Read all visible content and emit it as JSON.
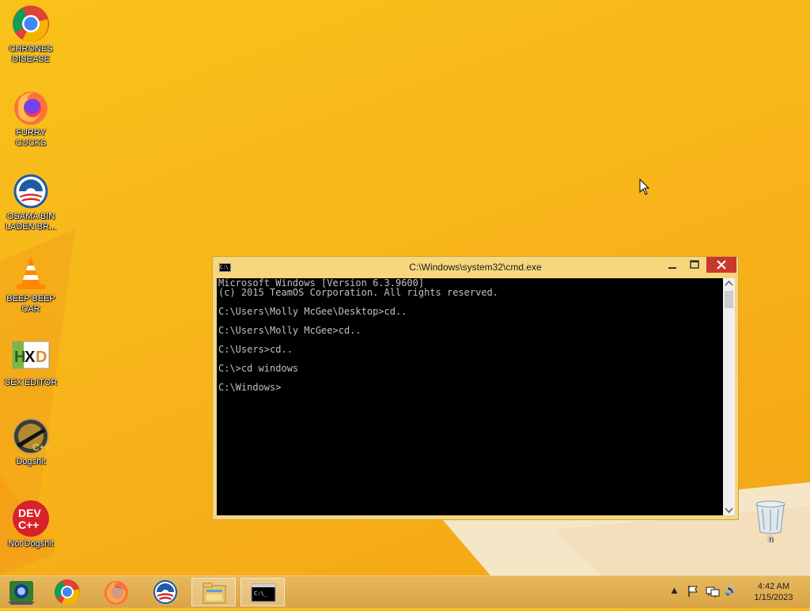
{
  "desktop": {
    "icons": [
      {
        "label": "CHRONES DISEASE",
        "icon": "chrome-icon"
      },
      {
        "label": "FURRY CUCKS",
        "icon": "firefox-icon"
      },
      {
        "label": "OSAMA BIN LADEN BR...",
        "icon": "campaign-logo-icon"
      },
      {
        "label": "BEEP BEEP CAR",
        "icon": "vlc-cone-icon"
      },
      {
        "label": "SEX EDITOR",
        "icon": "hxd-icon"
      },
      {
        "label": "Dogshit",
        "icon": "codeblocks-icon"
      },
      {
        "label": "Not Dogshit",
        "icon": "devcpp-icon"
      }
    ],
    "recycle_bin": {
      "label": "n",
      "icon": "recycle-bin-icon"
    }
  },
  "cmd_window": {
    "title": "C:\\Windows\\system32\\cmd.exe",
    "system_icon_text": "C:\\",
    "minimize": "—",
    "maximize": "☐",
    "close": "✕",
    "console_text": "Microsoft Windows [Version 6.3.9600]\n(c) 2015 TeamOS Corporation. All rights reserved.\n\nC:\\Users\\Molly McGee\\Desktop>cd..\n\nC:\\Users\\Molly McGee>cd..\n\nC:\\Users>cd..\n\nC:\\>cd windows\n\nC:\\Windows>"
  },
  "taskbar": {
    "pinned": [
      {
        "name": "devices-app",
        "icon": "device-manager-icon"
      },
      {
        "name": "chrome",
        "icon": "chrome-icon"
      },
      {
        "name": "firefox",
        "icon": "firefox-icon"
      },
      {
        "name": "campaign",
        "icon": "campaign-logo-icon"
      },
      {
        "name": "file-explorer",
        "icon": "folder-icon"
      },
      {
        "name": "cmd",
        "icon": "cmd-icon"
      }
    ],
    "cmd_icon_text": "C:\\_",
    "tray": {
      "chevron": "▲",
      "volume": "🔊"
    },
    "clock": {
      "time": "4:42 AM",
      "date": "1/15/2023"
    }
  },
  "colors": {
    "wallpaper": "#f8b51a",
    "taskbar": "#dfad50",
    "window_frame": "#f6d77e",
    "close_button": "#c7392b",
    "console_bg": "#000000",
    "console_fg": "#c0c0c0"
  }
}
